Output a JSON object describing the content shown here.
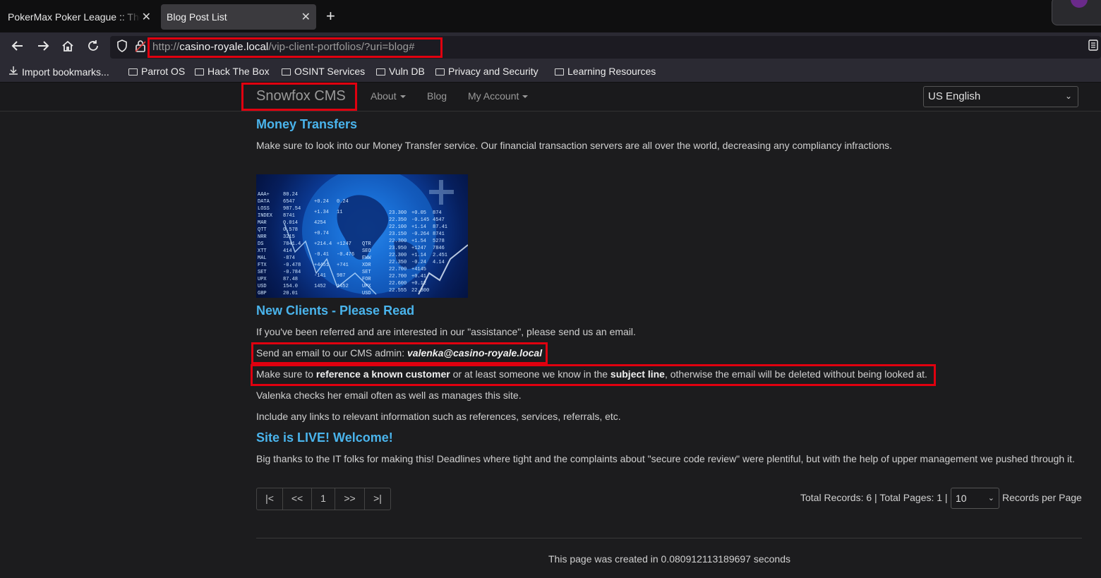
{
  "browser": {
    "tabs": [
      {
        "title": "PokerMax Poker League :: The Ultimate Poker League",
        "active": false
      },
      {
        "title": "Blog Post List",
        "active": true
      }
    ],
    "url": {
      "scheme": "http://",
      "host": "casino-royale.local",
      "path": "/vip-client-portfolios/?uri=blog#"
    },
    "bookmarks": [
      "Import bookmarks...",
      "Parrot OS",
      "Hack The Box",
      "OSINT Services",
      "Vuln DB",
      "Privacy and Security",
      "Learning Resources"
    ],
    "icons": {
      "back": "arrow-left",
      "forward": "arrow-right",
      "home": "home",
      "reload": "reload",
      "shield": "shield",
      "lock": "lock-insecure",
      "reader": "reader-view"
    }
  },
  "site": {
    "brand": "Snowfox CMS",
    "nav": {
      "about": "About",
      "blog": "Blog",
      "account": "My Account"
    },
    "language": "US English"
  },
  "posts": {
    "p1": {
      "title": "Money Transfers",
      "body": "Make sure to look into our Money Transfer service. Our financial transaction servers are all over the world, decreasing any compliancy infractions."
    },
    "p2": {
      "title": "New Clients - Please Read",
      "line1": "If you've been referred and are interested in our \"assistance\", please send us an email.",
      "line2_prefix": "Send an email to our CMS admin: ",
      "line2_email": "valenka@casino-royale.local",
      "line3_a": "Make sure to ",
      "line3_b": "reference a known customer",
      "line3_c": " or at least someone we know in the ",
      "line3_d": "subject line",
      "line3_e": ", otherwise the email will be deleted without being looked at.",
      "line4": "Valenka checks her email often as well as manages this site.",
      "line5": "Include any links to relevant information such as references, services, referrals, etc."
    },
    "p3": {
      "title": "Site is LIVE! Welcome!",
      "body": "Big thanks to the IT folks for making this! Deadlines where tight and the complaints about \"secure code review\" were plentiful, but with the help of upper management we pushed through it."
    }
  },
  "pagination": {
    "first": "|<",
    "prev": "<<",
    "page": "1",
    "next": ">>",
    "last": ">|",
    "summary": "Total Records: 6 | Total Pages: 1 |",
    "per_page": "10",
    "per_page_label": "Records per Page"
  },
  "footer": "This page was created in 0.080912113189697 seconds",
  "colors": {
    "annotation": "#e0000f",
    "heading": "#4ab4ec"
  }
}
